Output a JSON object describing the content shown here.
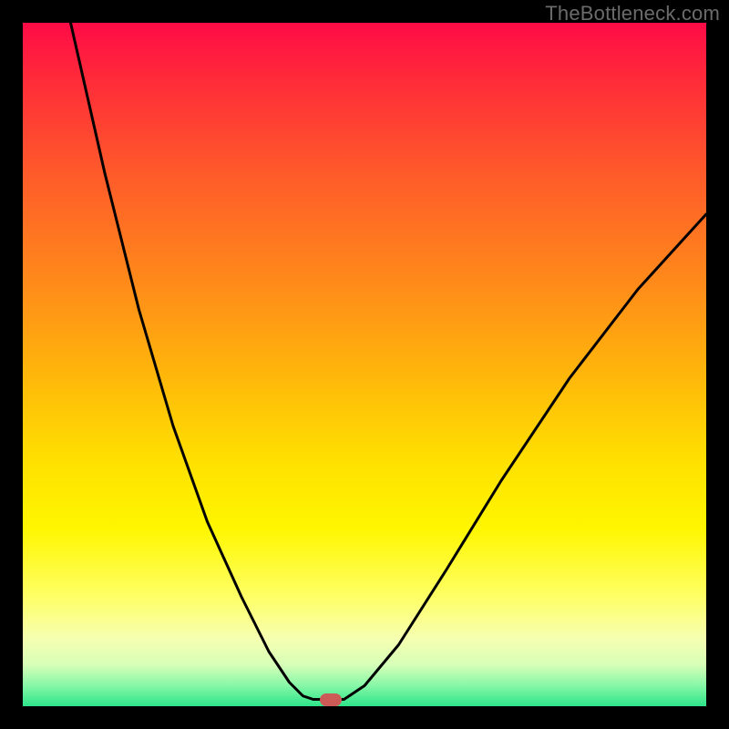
{
  "watermark": "TheBottleneck.com",
  "chart_data": {
    "type": "line",
    "title": "",
    "xlabel": "",
    "ylabel": "",
    "xlim": [
      0,
      100
    ],
    "ylim": [
      0,
      100
    ],
    "grid": false,
    "legend": false,
    "series": [
      {
        "name": "left-branch",
        "x": [
          7,
          12,
          17,
          22,
          27,
          32,
          36,
          39,
          41,
          42.5
        ],
        "y": [
          100,
          78,
          58,
          41,
          27,
          16,
          8,
          3.5,
          1.5,
          1
        ]
      },
      {
        "name": "bottom-flat",
        "x": [
          42.5,
          47
        ],
        "y": [
          1,
          1
        ]
      },
      {
        "name": "right-branch",
        "x": [
          47,
          50,
          55,
          62,
          70,
          80,
          90,
          100
        ],
        "y": [
          1,
          3,
          9,
          20,
          33,
          48,
          61,
          72
        ]
      }
    ],
    "marker": {
      "x": 45,
      "y": 1
    },
    "background": {
      "type": "vertical-gradient",
      "stops": [
        {
          "pos": 0,
          "color": "#ff0b46"
        },
        {
          "pos": 22,
          "color": "#ff5a2a"
        },
        {
          "pos": 52,
          "color": "#ffb80a"
        },
        {
          "pos": 74,
          "color": "#fff600"
        },
        {
          "pos": 90,
          "color": "#f6ffb0"
        },
        {
          "pos": 100,
          "color": "#2de58a"
        }
      ]
    }
  }
}
